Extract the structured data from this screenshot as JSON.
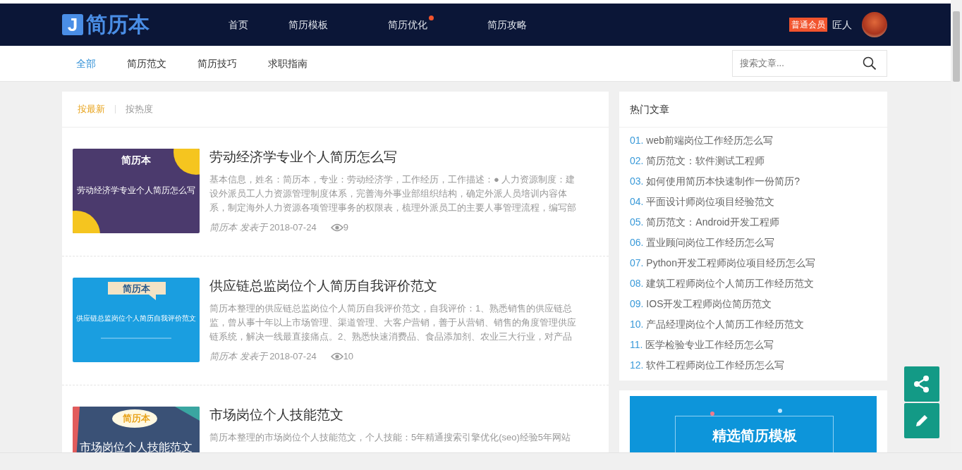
{
  "header": {
    "logo_letter": "J",
    "logo_text": "简历本",
    "nav": [
      {
        "label": "首页",
        "dot": false
      },
      {
        "label": "简历模板",
        "dot": false
      },
      {
        "label": "简历优化",
        "dot": true
      },
      {
        "label": "简历攻略",
        "dot": false
      }
    ],
    "member_badge": "普通会员",
    "username": "匠人"
  },
  "subnav": {
    "tabs": [
      {
        "label": "全部",
        "selected": true
      },
      {
        "label": "简历范文",
        "selected": false
      },
      {
        "label": "简历技巧",
        "selected": false
      },
      {
        "label": "求职指南",
        "selected": false
      }
    ],
    "search": {
      "placeholder": "搜索文章..."
    }
  },
  "sort_tabs": [
    {
      "label": "按最新",
      "selected": true
    },
    {
      "label": "按热度",
      "selected": false
    }
  ],
  "articles": [
    {
      "kind": "moon",
      "thumb_brand": "简历本",
      "thumb_title": "劳动经济学专业个人简历怎么写",
      "title": "劳动经济学专业个人简历怎么写",
      "excerpt": "基本信息，姓名：简历本，专业：劳动经济学，工作经历，工作描述：● 人力资源制度：建设外派员工人力资源管理制度体系，完善海外事业部组织结构，确定外派人员培训内容体系，制定海外人力资源各项管理事务的权限表，梳理外派员工的主要人事管理流程，编写部",
      "author": "简历本 发表于",
      "date": "2018-07-24",
      "views": "9"
    },
    {
      "kind": "ribbon",
      "thumb_brand": "简历本",
      "thumb_title": "供应链总监岗位个人简历自我评价范文",
      "title": "供应链总监岗位个人简历自我评价范文",
      "excerpt": "简历本整理的供应链总监岗位个人简历自我评价范文，自我评价：1、熟悉销售的供应链总监，曾从事十年以上市场管理、渠道管理、大客户营销，善于从营销、销售的角度管理供应链系统，解决一线最直接痛点。2、熟悉快速消费品、食品添加剂、农业三大行业，对产品",
      "author": "简历本 发表于",
      "date": "2018-07-24",
      "views": "10"
    },
    {
      "kind": "bubble",
      "thumb_brand": "简历本",
      "thumb_title": "市场岗位个人技能范文",
      "title": "市场岗位个人技能范文",
      "excerpt": "简历本整理的市场岗位个人技能范文，个人技能：5年精通搜索引擎优化(seo)经验5年网站"
    }
  ],
  "hot": {
    "title": "热门文章",
    "items": [
      {
        "num": "01.",
        "text": "web前端岗位工作经历怎么写"
      },
      {
        "num": "02.",
        "text": "简历范文：软件测试工程师"
      },
      {
        "num": "03.",
        "text": "如何使用简历本快速制作一份简历?"
      },
      {
        "num": "04.",
        "text": "平面设计师岗位项目经验范文"
      },
      {
        "num": "05.",
        "text": "简历范文：Android开发工程师"
      },
      {
        "num": "06.",
        "text": "置业顾问岗位工作经历怎么写"
      },
      {
        "num": "07.",
        "text": "Python开发工程师岗位项目经历怎么写"
      },
      {
        "num": "08.",
        "text": "建筑工程师岗位个人简历工作经历范文"
      },
      {
        "num": "09.",
        "text": "IOS开发工程师岗位简历范文"
      },
      {
        "num": "10.",
        "text": "产品经理岗位个人简历工作经历范文"
      },
      {
        "num": "11.",
        "text": "医学检验专业工作经历怎么写"
      },
      {
        "num": "12.",
        "text": "软件工程师岗位工作经历怎么写"
      }
    ]
  },
  "banner": {
    "text": "精选简历模板"
  }
}
